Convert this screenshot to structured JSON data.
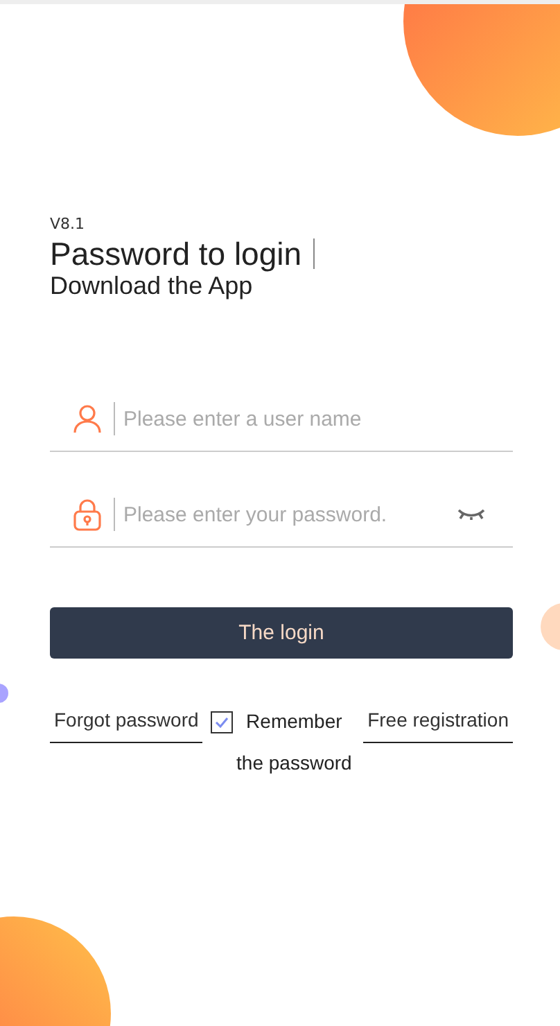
{
  "version": "V8.1",
  "title": "Password to login",
  "download_link": "Download the App",
  "fields": [
    {
      "kind": "user",
      "placeholder": "Please enter a user name"
    },
    {
      "kind": "password",
      "placeholder": "Please enter your password."
    }
  ],
  "login_button": "The login",
  "forgot_link": "Forgot password",
  "remember": {
    "label": "Remember the password",
    "checked": true
  },
  "register_link": "Free registration"
}
